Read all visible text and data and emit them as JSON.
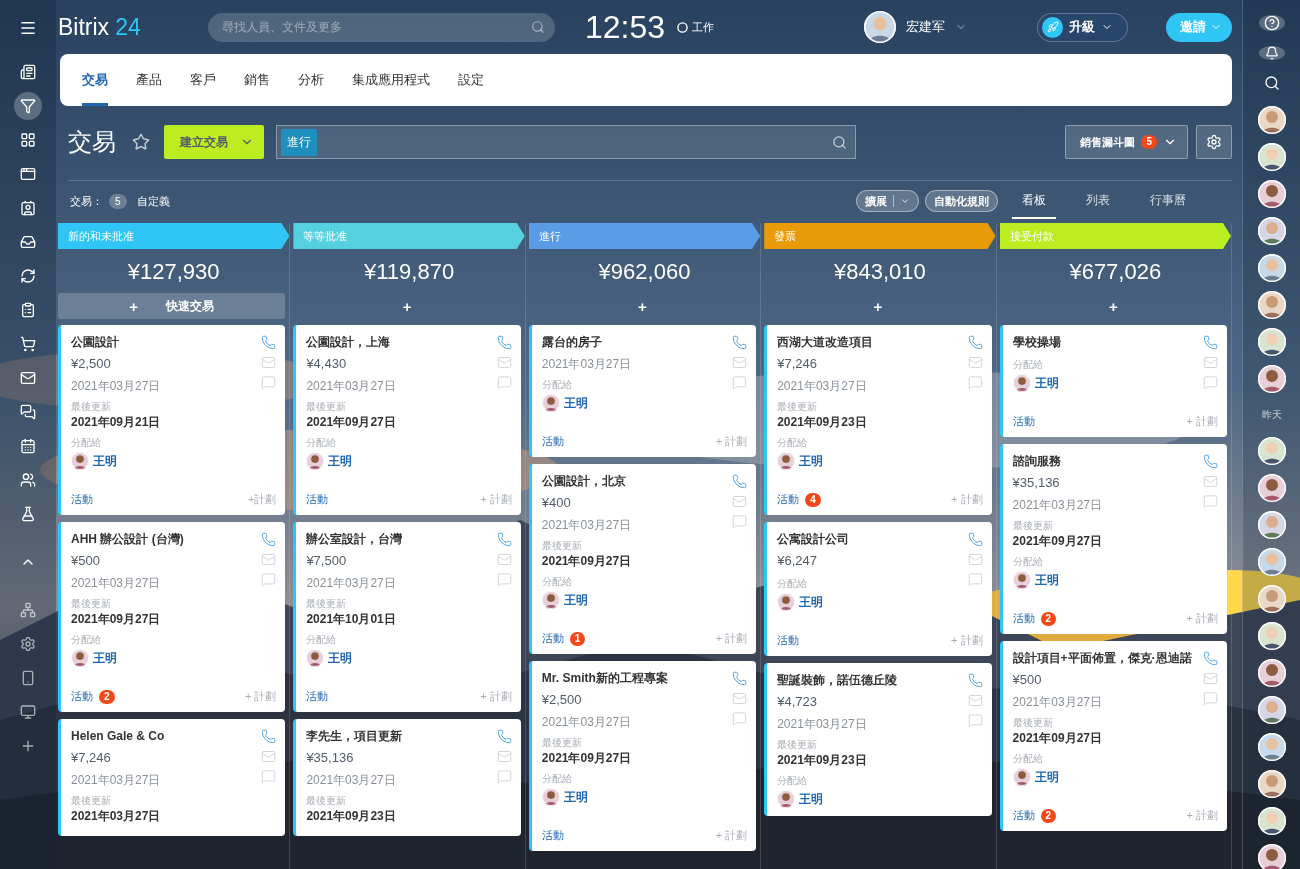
{
  "app": {
    "logo_name": "Bitrix",
    "logo_number": "24",
    "search_placeholder": "尋找人員、文件及更多",
    "time": "12:53",
    "work_status": "工作",
    "user_name": "宏建军",
    "upgrade": "升級",
    "invite": "邀請"
  },
  "left_sidebar": {
    "items": [
      {
        "kind": "feed",
        "selected": false
      },
      {
        "kind": "crm",
        "selected": true
      },
      {
        "kind": "apps",
        "selected": false
      },
      {
        "kind": "sites",
        "selected": false
      },
      {
        "kind": "contacts",
        "selected": false
      },
      {
        "kind": "drive",
        "selected": false
      },
      {
        "kind": "sync",
        "selected": false
      },
      {
        "kind": "tasks",
        "selected": false
      },
      {
        "kind": "shop",
        "selected": false
      },
      {
        "kind": "mail",
        "selected": false
      },
      {
        "kind": "chat",
        "selected": false
      },
      {
        "kind": "calendar",
        "selected": false
      },
      {
        "kind": "groups",
        "selected": false
      },
      {
        "kind": "lab",
        "selected": false
      },
      {
        "kind": "collapse",
        "selected": false
      },
      {
        "kind": "network",
        "selected": false
      },
      {
        "kind": "settings",
        "selected": false
      },
      {
        "kind": "mobile",
        "selected": false
      },
      {
        "kind": "desktop",
        "selected": false
      },
      {
        "kind": "add",
        "selected": false
      }
    ]
  },
  "nav_tabs": [
    {
      "label": "交易",
      "selected": true
    },
    {
      "label": "產品",
      "selected": false
    },
    {
      "label": "客戶",
      "selected": false
    },
    {
      "label": "銷售",
      "selected": false
    },
    {
      "label": "分析",
      "selected": false
    },
    {
      "label": "集成應用程式",
      "selected": false
    },
    {
      "label": "設定",
      "selected": false
    }
  ],
  "toolbar": {
    "title": "交易",
    "create_button": "建立交易",
    "filter_tag": "進行",
    "pipeline_button": "銷售漏斗圖",
    "pipeline_count": "5"
  },
  "summary": {
    "label": "交易：",
    "count": "5",
    "custom": "自定義"
  },
  "view_controls": {
    "extend": "擴展",
    "automation": "自動化規則",
    "views": [
      {
        "label": "看板",
        "selected": true
      },
      {
        "label": "列表",
        "selected": false
      },
      {
        "label": "行事曆",
        "selected": false
      }
    ]
  },
  "columns": [
    {
      "title": "新的和未批准",
      "color": "#2fc6f6",
      "total": "¥127,930",
      "quick_add": "+",
      "quick_label": "快速交易",
      "cards": [
        {
          "title": "公園設計",
          "amount": "¥2,500",
          "created": "2021年03月27日",
          "updated_label": "最後更新",
          "updated": "2021年09月21日",
          "assign_label": "分配給",
          "assignee": "王明",
          "activity": "活動",
          "plan": "+計劃"
        },
        {
          "title": "AHH 辦公設計 (台灣)",
          "amount": "¥500",
          "created": "2021年03月27日",
          "updated_label": "最後更新",
          "updated": "2021年09月27日",
          "assign_label": "分配給",
          "assignee": "王明",
          "activity": "活動",
          "activity_count": "2",
          "plan": "+ 計劃"
        },
        {
          "title": "Helen Gale & Co",
          "amount": "¥7,246",
          "created": "2021年03月27日",
          "updated_label": "最後更新",
          "updated": "2021年03月27日"
        }
      ]
    },
    {
      "title": "等等批准",
      "color": "#55d0e0",
      "total": "¥119,870",
      "quick_add": "+",
      "cards": [
        {
          "title": "公園設計，上海",
          "amount": "¥4,430",
          "created": "2021年03月27日",
          "updated_label": "最後更新",
          "updated": "2021年09月27日",
          "assign_label": "分配給",
          "assignee": "王明",
          "activity": "活動",
          "plan": "+ 計劃"
        },
        {
          "title": "辦公室設計，台灣",
          "amount": "¥7,500",
          "created": "2021年03月27日",
          "updated_label": "最後更新",
          "updated": "2021年10月01日",
          "assign_label": "分配給",
          "assignee": "王明",
          "activity": "活動",
          "plan": "+ 計劃"
        },
        {
          "title": "李先生，項目更新",
          "amount": "¥35,136",
          "created": "2021年03月27日",
          "updated_label": "最後更新",
          "updated": "2021年09月23日"
        }
      ]
    },
    {
      "title": "進行",
      "color": "#5a9be6",
      "total": "¥962,060",
      "quick_add": "+",
      "cards": [
        {
          "title": "露台的房子",
          "created": "2021年03月27日",
          "assign_label": "分配給",
          "assignee": "王明",
          "activity": "活動",
          "plan": "+ 計劃"
        },
        {
          "title": "公園設計，北京",
          "amount": "¥400",
          "created": "2021年03月27日",
          "updated_label": "最後更新",
          "updated": "2021年09月27日",
          "assign_label": "分配給",
          "assignee": "王明",
          "activity": "活動",
          "activity_count": "1",
          "plan": "+ 計劃"
        },
        {
          "title": "Mr. Smith新的工程專案",
          "amount": "¥2,500",
          "created": "2021年03月27日",
          "updated_label": "最後更新",
          "updated": "2021年09月27日",
          "assign_label": "分配給",
          "assignee": "王明",
          "activity": "活動",
          "plan": "+ 計劃"
        }
      ]
    },
    {
      "title": "發票",
      "color": "#e89b06",
      "total": "¥843,010",
      "quick_add": "+",
      "cards": [
        {
          "title": "西湖大道改造項目",
          "amount": "¥7,246",
          "created": "2021年03月27日",
          "updated_label": "最後更新",
          "updated": "2021年09月23日",
          "assign_label": "分配給",
          "assignee": "王明",
          "activity": "活動",
          "activity_count": "4",
          "plan": "+ 計劃"
        },
        {
          "title": "公寓設計公司",
          "amount": "¥6,247",
          "assign_label": "分配給",
          "assignee": "王明",
          "activity": "活動",
          "plan": "+ 計劃"
        },
        {
          "title": "聖誕裝飾，諾伍德丘陵",
          "amount": "¥4,723",
          "created": "2021年03月27日",
          "updated_label": "最後更新",
          "updated": "2021年09月23日",
          "assign_label": "分配給",
          "assignee": "王明"
        }
      ]
    },
    {
      "title": "接受付款",
      "color": "#bbed21",
      "total": "¥677,026",
      "quick_add": "+",
      "cards": [
        {
          "title": "學校操場",
          "assign_label": "分配給",
          "assignee": "王明",
          "activity": "活動",
          "plan": "+ 計劃"
        },
        {
          "title": "諮詢服務",
          "amount": "¥35,136",
          "created": "2021年03月27日",
          "updated_label": "最後更新",
          "updated": "2021年09月27日",
          "assign_label": "分配給",
          "assignee": "王明",
          "activity": "活動",
          "activity_count": "2",
          "plan": "+ 計劃"
        },
        {
          "title": "設計項目+平面佈置，傑克·恩迪諾",
          "amount": "¥500",
          "created": "2021年03月27日",
          "updated_label": "最後更新",
          "updated": "2021年09月27日",
          "assign_label": "分配給",
          "assignee": "王明",
          "activity": "活動",
          "activity_count": "2",
          "plan": "+ 計劃"
        }
      ]
    }
  ],
  "right_sidebar": {
    "section_label": "昨天"
  }
}
